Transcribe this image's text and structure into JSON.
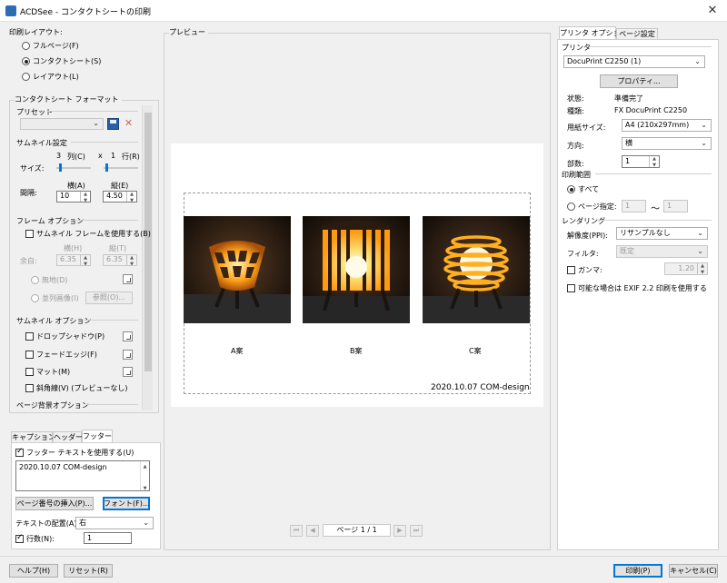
{
  "window": {
    "title": "ACDSee - コンタクトシートの印刷"
  },
  "left": {
    "layout_group": "印刷レイアウト:",
    "layout_options": [
      "フルページ(F)",
      "コンタクトシート(S)",
      "レイアウト(L)"
    ],
    "format_group": "コンタクトシート フォーマット",
    "preset_label": "プリセット",
    "thumb_settings": "サムネイル設定",
    "size_label": "サイズ:",
    "cols_value": "3",
    "cols_label": "列(C)",
    "x_label": "x",
    "rows_value": "1",
    "rows_label": "行(R)",
    "spacing_label": "間隔:",
    "horiz_label": "横(A)",
    "vert_label": "縦(E)",
    "horiz_value": "10",
    "vert_value": "4.50",
    "frame_options": "フレーム オプション",
    "use_thumb_frame": "サムネイル フレームを使用する(B)",
    "margin_label": "余白:",
    "margin_h_label": "横(H)",
    "margin_v_label": "縦(T)",
    "margin_h_value": "6.35",
    "margin_v_value": "6.35",
    "plain_label": "無地(D)",
    "tile_label": "並列画像(I)",
    "browse_label": "参照(O)...",
    "thumb_options": "サムネイル オプション",
    "drop_shadow": "ドロップシャドウ(P)",
    "fade_edge": "フェードエッジ(F)",
    "matte": "マット(M)",
    "bevel": "斜角線(V) (プレビューなし)",
    "page_bg": "ページ背景オプション"
  },
  "footer_tabs": {
    "tabs": [
      "キャプション",
      "ヘッダー",
      "フッター"
    ],
    "use_footer": "フッター テキストを使用する(U)",
    "footer_text": "2020.10.07 COM-design",
    "insert_page_btn": "ページ番号の挿入(P)...",
    "font_btn": "フォント(F)...",
    "align_label": "テキストの配置(A):",
    "align_value": "右",
    "lines_label": "行数(N):",
    "lines_value": "1"
  },
  "preview": {
    "group_label": "プレビュー",
    "captions": [
      "A案",
      "B案",
      "C案"
    ],
    "footer": "2020.10.07 COM-design",
    "page_indicator": "ページ 1 / 1"
  },
  "right": {
    "tabs": [
      "プリンタ オプション",
      "ページ設定"
    ],
    "printer_group": "プリンタ",
    "printer_name": "DocuPrint C2250 (1)",
    "properties_btn": "プロパティ...",
    "status_label": "状態:",
    "status_value": "準備完了",
    "type_label": "種類:",
    "type_value": "FX DocuPrint C2250",
    "paper_label": "用紙サイズ:",
    "paper_value": "A4 (210x297mm)",
    "orient_label": "方向:",
    "orient_value": "横",
    "copies_label": "部数:",
    "copies_value": "1",
    "range_group": "印刷範囲",
    "range_all": "すべて",
    "range_pages": "ページ指定:",
    "range_from": "1",
    "range_tilde": "〜",
    "range_to": "1",
    "render_group": "レンダリング",
    "res_label": "解像度(PPI):",
    "res_value": "リサンプルなし",
    "filter_label": "フィルタ:",
    "filter_value": "既定",
    "gamma_label": "ガンマ:",
    "gamma_value": "1.20",
    "exif_label": "可能な場合は EXIF 2.2 印刷を使用する"
  },
  "bottom": {
    "help": "ヘルプ(H)",
    "reset": "リセット(R)",
    "print": "印刷(P)",
    "cancel": "キャンセル(C)"
  },
  "colors": {
    "accent": "#0078d7",
    "lamp_glow": "#ffb020"
  }
}
